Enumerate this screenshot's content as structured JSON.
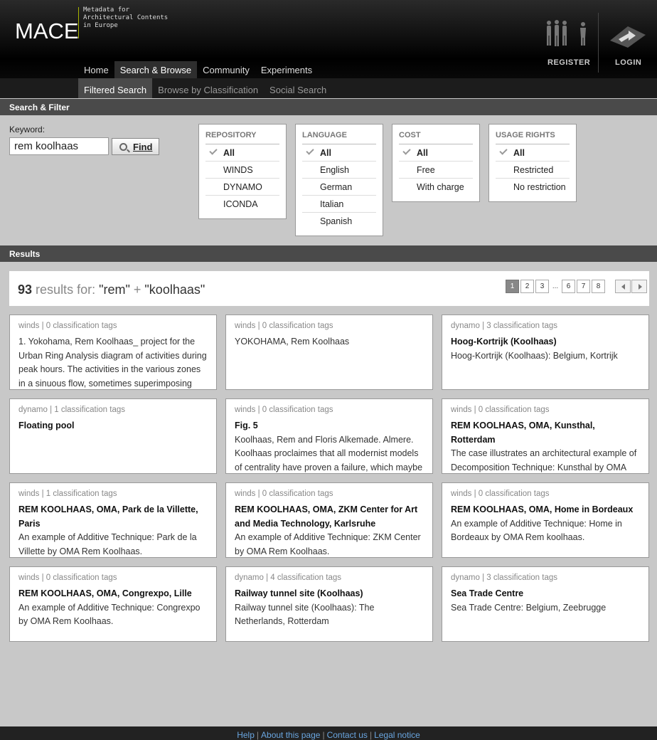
{
  "header": {
    "logo": "MACE",
    "tagline": "Metadata for\nArchitectural Contents\nin Europe",
    "register_label": "REGISTER",
    "login_label": "LOGIN"
  },
  "mainnav": [
    "Home",
    "Search & Browse",
    "Community",
    "Experiments"
  ],
  "subnav": [
    "Filtered Search",
    "Browse by Classification",
    "Social Search"
  ],
  "search_section": {
    "title": "Search & Filter",
    "keyword_label": "Keyword:",
    "keyword_value": "rem koolhaas",
    "find_label": "Find"
  },
  "filters": {
    "repository": {
      "title": "REPOSITORY",
      "options": [
        "All",
        "WINDS",
        "DYNAMO",
        "ICONDA"
      ]
    },
    "language": {
      "title": "LANGUAGE",
      "options": [
        "All",
        "English",
        "German",
        "Italian",
        "Spanish"
      ]
    },
    "cost": {
      "title": "COST",
      "options": [
        "All",
        "Free",
        "With charge"
      ]
    },
    "usage": {
      "title": "USAGE RIGHTS",
      "options": [
        "All",
        "Restricted",
        "No restriction"
      ]
    }
  },
  "results_section": {
    "title": "Results",
    "count": "93",
    "results_for": "results for:",
    "q1": "\"rem\"",
    "plus": "+",
    "q2": "\"koolhaas\"",
    "pages": [
      "1",
      "2",
      "3",
      "...",
      "6",
      "7",
      "8"
    ]
  },
  "cards": [
    {
      "meta": "winds | 0 classification tags",
      "title": "",
      "desc": "1. Yokohama, Rem Koolhaas_ project for the Urban Ring Analysis diagram of activities during peak hours. The activities in the various zones in a sinuous flow, sometimes superimposing"
    },
    {
      "meta": "winds | 0 classification tags",
      "title": "",
      "desc": "YOKOHAMA, Rem Koolhaas"
    },
    {
      "meta": "dynamo | 3 classification tags",
      "title": "Hoog-Kortrijk (Koolhaas)",
      "desc": "Hoog-Kortrijk (Koolhaas): Belgium, Kortrijk"
    },
    {
      "meta": "dynamo | 1 classification tags",
      "title": "Floating pool",
      "desc": ""
    },
    {
      "meta": "winds | 0 classification tags",
      "title": "Fig. 5",
      "desc": "Koolhaas, Rem and Floris Alkemade. Almere. Koolhaas proclaimes that all modernist models of centrality have proven a failure, which maybe"
    },
    {
      "meta": "winds | 0 classification tags",
      "title": "REM KOOLHAAS, OMA, Kunsthal, Rotterdam",
      "desc": "The case illustrates an architectural example of Decomposition Technique: Kunsthal by OMA Rem Koolhaas"
    },
    {
      "meta": "winds | 1 classification tags",
      "title": "REM KOOLHAAS, OMA, Park de la Villette, Paris",
      "desc": "An example of Additive Technique: Park de la Villette by OMA Rem Koolhaas."
    },
    {
      "meta": "winds | 0 classification tags",
      "title": "REM KOOLHAAS, OMA, ZKM Center for Art and Media Technology, Karlsruhe",
      "desc": "An example of Additive Technique: ZKM Center by OMA Rem Koolhaas."
    },
    {
      "meta": "winds | 0 classification tags",
      "title": "REM KOOLHAAS, OMA, Home in Bordeaux",
      "desc": "An example of Additive Technique: Home in Bordeaux by OMA Rem koolhaas."
    },
    {
      "meta": "winds | 0 classification tags",
      "title": "REM KOOLHAAS, OMA, Congrexpo, Lille",
      "desc": "An example of Additive Technique: Congrexpo by OMA Rem Koolhaas."
    },
    {
      "meta": "dynamo | 4 classification tags",
      "title": "Railway tunnel site (Koolhaas)",
      "desc": "Railway tunnel site (Koolhaas): The Netherlands, Rotterdam"
    },
    {
      "meta": "dynamo | 3 classification tags",
      "title": "Sea Trade Centre",
      "desc": "Sea Trade Centre: Belgium, Zeebrugge"
    }
  ],
  "footer": [
    "Help",
    "About this page",
    "Contact us",
    "Legal notice"
  ]
}
